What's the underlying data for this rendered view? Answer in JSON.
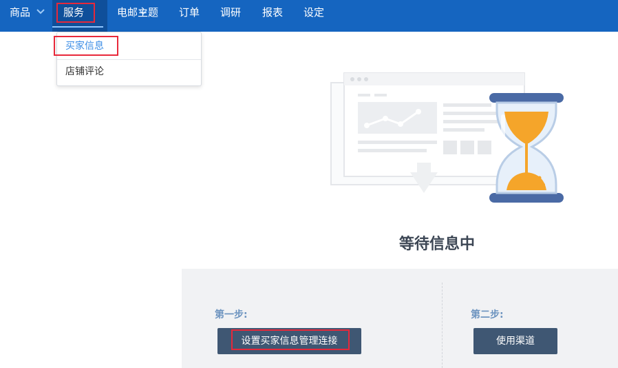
{
  "nav": {
    "items": [
      {
        "label": "商品"
      },
      {
        "label": "服务"
      },
      {
        "label": "电邮主题"
      },
      {
        "label": "订单"
      },
      {
        "label": "调研"
      },
      {
        "label": "报表"
      },
      {
        "label": "设定"
      }
    ],
    "active_index": 1
  },
  "dropdown": {
    "items": [
      {
        "label": "买家信息",
        "active": true
      },
      {
        "label": "店铺评论",
        "active": false
      }
    ]
  },
  "main": {
    "waiting_title": "等待信息中",
    "step1": {
      "label": "第一步:",
      "button": "设置买家信息管理连接"
    },
    "step2": {
      "label": "第二步:",
      "button": "使用渠道"
    }
  },
  "colors": {
    "nav_bg": "#1565c0",
    "nav_active_bg": "#0f4f9a",
    "highlight": "#e8283a",
    "button_bg": "#3f5773",
    "step_label": "#6c93bf",
    "hourglass_sand": "#f5a52a",
    "hourglass_frame": "#4a6aa5"
  },
  "icons": {
    "nav_chevron": "chevron-down-icon",
    "illustration": "hourglass-icon"
  }
}
